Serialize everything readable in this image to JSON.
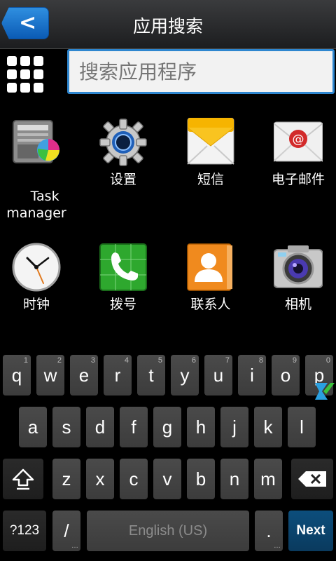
{
  "header": {
    "title": "应用搜索",
    "back_glyph": "<"
  },
  "search": {
    "placeholder": "搜索应用程序"
  },
  "apps": [
    {
      "label": "Task\nmanager",
      "icon": "task-manager-icon"
    },
    {
      "label": "设置",
      "icon": "settings-gear-icon"
    },
    {
      "label": "短信",
      "icon": "message-envelope-icon"
    },
    {
      "label": "电子邮件",
      "icon": "email-icon"
    },
    {
      "label": "时钟",
      "icon": "clock-icon"
    },
    {
      "label": "拨号",
      "icon": "phone-dialer-icon"
    },
    {
      "label": "联系人",
      "icon": "contacts-icon"
    },
    {
      "label": "相机",
      "icon": "camera-icon"
    }
  ],
  "keyboard": {
    "row1": [
      {
        "key": "q",
        "hint": "1"
      },
      {
        "key": "w",
        "hint": "2"
      },
      {
        "key": "e",
        "hint": "3"
      },
      {
        "key": "r",
        "hint": "4"
      },
      {
        "key": "t",
        "hint": "5"
      },
      {
        "key": "y",
        "hint": "6"
      },
      {
        "key": "u",
        "hint": "7"
      },
      {
        "key": "i",
        "hint": "8"
      },
      {
        "key": "o",
        "hint": "9"
      },
      {
        "key": "p",
        "hint": "0"
      }
    ],
    "row2": [
      "a",
      "s",
      "d",
      "f",
      "g",
      "h",
      "j",
      "k",
      "l"
    ],
    "row3": [
      "z",
      "x",
      "c",
      "v",
      "b",
      "n",
      "m"
    ],
    "symbols_label": "?123",
    "slash_label": "/",
    "space_label": "English (US)",
    "period_label": ".",
    "next_label": "Next"
  },
  "colors": {
    "accent": "#2e86cf",
    "next_key": "#0c4e7c"
  }
}
